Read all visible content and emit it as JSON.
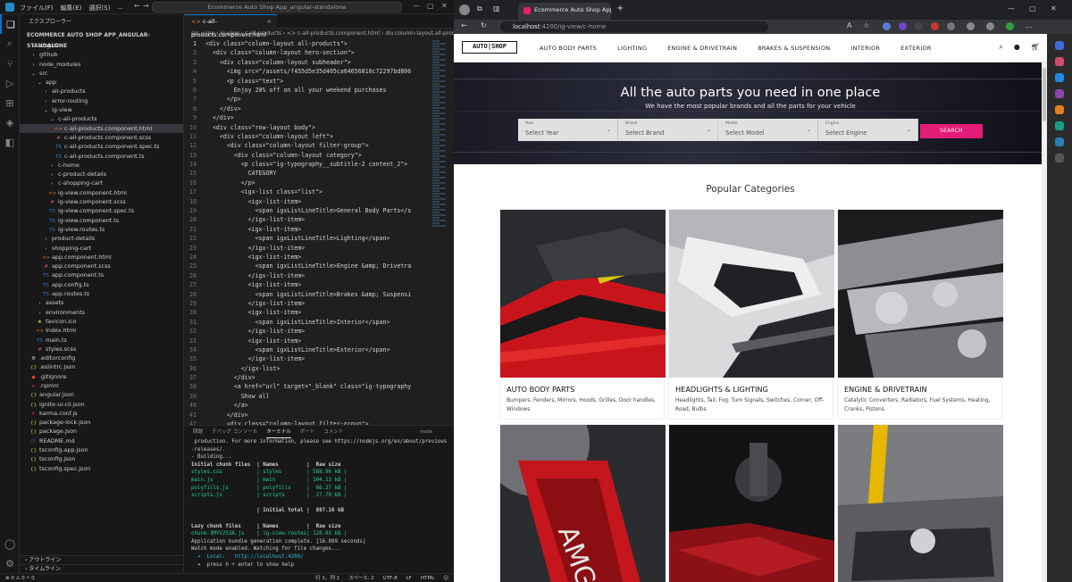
{
  "vscode": {
    "menus": [
      "ファイル(F)",
      "編集(E)",
      "選択(S)",
      "..."
    ],
    "command_center": "Ecommerce Auto Shop App_angular-standalone",
    "explorer_title": "エクスプローラー",
    "project_name": "ECOMMERCE AUTO SHOP APP_ANGULAR-STANDALONE",
    "tree": [
      {
        "label": "angular",
        "indent": 1,
        "icon": "›"
      },
      {
        "label": "github",
        "indent": 1,
        "icon": "›"
      },
      {
        "label": "node_modules",
        "indent": 1,
        "icon": "›"
      },
      {
        "label": "src",
        "indent": 1,
        "icon": "⌄"
      },
      {
        "label": "app",
        "indent": 2,
        "icon": "⌄"
      },
      {
        "label": "all-products",
        "indent": 3,
        "icon": "›"
      },
      {
        "label": "error-routing",
        "indent": 3,
        "icon": "›"
      },
      {
        "label": "ig-view",
        "indent": 3,
        "icon": "⌄"
      },
      {
        "label": "c-all-products",
        "indent": 4,
        "icon": "⌄"
      },
      {
        "label": "c-all-products.component.html",
        "indent": 5,
        "icon": "<>",
        "selected": true
      },
      {
        "label": "c-all-products.component.scss",
        "indent": 5,
        "icon": "#"
      },
      {
        "label": "c-all-products.component.spec.ts",
        "indent": 5,
        "icon": "TS"
      },
      {
        "label": "c-all-products.component.ts",
        "indent": 5,
        "icon": "TS"
      },
      {
        "label": "c-home",
        "indent": 4,
        "icon": "›"
      },
      {
        "label": "c-product-details",
        "indent": 4,
        "icon": "›"
      },
      {
        "label": "c-shopping-cart",
        "indent": 4,
        "icon": "›"
      },
      {
        "label": "ig-view.component.html",
        "indent": 4,
        "icon": "<>"
      },
      {
        "label": "ig-view.component.scss",
        "indent": 4,
        "icon": "#"
      },
      {
        "label": "ig-view.component.spec.ts",
        "indent": 4,
        "icon": "TS"
      },
      {
        "label": "ig-view.component.ts",
        "indent": 4,
        "icon": "TS"
      },
      {
        "label": "ig-view.routes.ts",
        "indent": 4,
        "icon": "TS"
      },
      {
        "label": "product-details",
        "indent": 3,
        "icon": "›"
      },
      {
        "label": "shopping-cart",
        "indent": 3,
        "icon": "›"
      },
      {
        "label": "app.component.html",
        "indent": 3,
        "icon": "<>"
      },
      {
        "label": "app.component.scss",
        "indent": 3,
        "icon": "#"
      },
      {
        "label": "app.component.ts",
        "indent": 3,
        "icon": "TS"
      },
      {
        "label": "app.config.ts",
        "indent": 3,
        "icon": "TS"
      },
      {
        "label": "app.routes.ts",
        "indent": 3,
        "icon": "TS"
      },
      {
        "label": "assets",
        "indent": 2,
        "icon": "›"
      },
      {
        "label": "environments",
        "indent": 2,
        "icon": "›"
      },
      {
        "label": "favicon.ico",
        "indent": 2,
        "icon": "★"
      },
      {
        "label": "index.html",
        "indent": 2,
        "icon": "<>"
      },
      {
        "label": "main.ts",
        "indent": 2,
        "icon": "TS"
      },
      {
        "label": "styles.scss",
        "indent": 2,
        "icon": "#"
      },
      {
        "label": ".editorconfig",
        "indent": 1,
        "icon": "⚙"
      },
      {
        "label": ".eslintrc.json",
        "indent": 1,
        "icon": "{}"
      },
      {
        "label": ".gitignore",
        "indent": 1,
        "icon": "◆"
      },
      {
        "label": ".npmrc",
        "indent": 1,
        "icon": "n"
      },
      {
        "label": "angular.json",
        "indent": 1,
        "icon": "{}"
      },
      {
        "label": "ignite-ui-cli.json",
        "indent": 1,
        "icon": "{}"
      },
      {
        "label": "karma.conf.js",
        "indent": 1,
        "icon": "K"
      },
      {
        "label": "package-lock.json",
        "indent": 1,
        "icon": "{}"
      },
      {
        "label": "package.json",
        "indent": 1,
        "icon": "{}"
      },
      {
        "label": "README.md",
        "indent": 1,
        "icon": "ⓘ"
      },
      {
        "label": "tsconfig.app.json",
        "indent": 1,
        "icon": "{}"
      },
      {
        "label": "tsconfig.json",
        "indent": 1,
        "icon": "{}"
      },
      {
        "label": "tsconfig.spec.json",
        "indent": 1,
        "icon": "{}"
      }
    ],
    "outline_label": "アウトライン",
    "timeline_label": "タイムライン",
    "tab_label": "c-all-products.component.html",
    "breadcrumb": "src › app › ig-view › c-all-products › <> c-all-products.component.html › div.column-layout.all-products",
    "code": [
      {
        "n": "1",
        "t": "<div class=\"column-layout all-products\">"
      },
      {
        "n": "2",
        "t": "  <div class=\"column-layout hero-section\">"
      },
      {
        "n": "3",
        "t": "    <div class=\"column-layout subheader\">"
      },
      {
        "n": "4",
        "t": "      <img src=\"/assets/f455d5e35d405ca64656810c72297bd806"
      },
      {
        "n": "5",
        "t": "      <p class=\"text\">"
      },
      {
        "n": "6",
        "t": "        Enjoy 20% off on all your weekend purchases"
      },
      {
        "n": "7",
        "t": "      </p>"
      },
      {
        "n": "8",
        "t": "    </div>"
      },
      {
        "n": "9",
        "t": "  </div>"
      },
      {
        "n": "10",
        "t": "  <div class=\"row-layout body\">"
      },
      {
        "n": "11",
        "t": "    <div class=\"column-layout left\">"
      },
      {
        "n": "12",
        "t": "      <div class=\"column-layout filter-group\">"
      },
      {
        "n": "13",
        "t": "        <div class=\"column-layout category\">"
      },
      {
        "n": "14",
        "t": "          <p class=\"ig-typography__subtitle-2 content_2\">"
      },
      {
        "n": "15",
        "t": "            CATEGORY"
      },
      {
        "n": "16",
        "t": "          </p>"
      },
      {
        "n": "17",
        "t": "          <igx-list class=\"list\">"
      },
      {
        "n": "18",
        "t": "            <igx-list-item>"
      },
      {
        "n": "19",
        "t": "              <span igxListLineTitle>General Body Parts</s"
      },
      {
        "n": "20",
        "t": "            </igx-list-item>"
      },
      {
        "n": "21",
        "t": "            <igx-list-item>"
      },
      {
        "n": "22",
        "t": "              <span igxListLineTitle>Lighting</span>"
      },
      {
        "n": "23",
        "t": "            </igx-list-item>"
      },
      {
        "n": "24",
        "t": "            <igx-list-item>"
      },
      {
        "n": "25",
        "t": "              <span igxListLineTitle>Engine &amp; Drivetra"
      },
      {
        "n": "26",
        "t": "            </igx-list-item>"
      },
      {
        "n": "27",
        "t": "            <igx-list-item>"
      },
      {
        "n": "28",
        "t": "              <span igxListLineTitle>Brakes &amp; Suspensi"
      },
      {
        "n": "29",
        "t": "            </igx-list-item>"
      },
      {
        "n": "30",
        "t": "            <igx-list-item>"
      },
      {
        "n": "31",
        "t": "              <span igxListLineTitle>Interior</span>"
      },
      {
        "n": "32",
        "t": "            </igx-list-item>"
      },
      {
        "n": "33",
        "t": "            <igx-list-item>"
      },
      {
        "n": "34",
        "t": "              <span igxListLineTitle>Exterior</span>"
      },
      {
        "n": "35",
        "t": "            </igx-list-item>"
      },
      {
        "n": "36",
        "t": "          </igx-list>"
      },
      {
        "n": "37",
        "t": "        </div>"
      },
      {
        "n": "38",
        "t": "        <a href=\"url\" target=\"_blank\" class=\"ig-typography"
      },
      {
        "n": "39",
        "t": "          Show all"
      },
      {
        "n": "40",
        "t": "        </a>"
      },
      {
        "n": "41",
        "t": "      </div>"
      },
      {
        "n": "42",
        "t": "      <div class=\"column-layout filter-group\">"
      }
    ],
    "panel_tabs": [
      "問題",
      "デバッグ コンソール",
      "ターミナル",
      "ポート",
      "コメント"
    ],
    "panel_active": "ターミナル",
    "terminal_shell": "node",
    "terminal": [
      " production. For more information, please see https://nodejs.org/en/about/previous",
      "-releases/.",
      "- Building...",
      "Initial chunk files  | Names         |  Raw size",
      "styles.css           | styles        | 588.96 kB |",
      "main.js              | main          | 104.13 kB |",
      "polyfills.js         | polyfills     |  86.27 kB |",
      "scripts.js           | scripts       |  27.79 kB |",
      "",
      "                     | Initial total |  807.16 kB",
      "",
      "Lazy chunk files     | Names         |  Raw size",
      "chunk-3MYV253A.js    | ig-view-routes| 120.01 kB |",
      "Application bundle generation complete. [16.899 seconds]",
      "Watch mode enabled. Watching for file changes...",
      "  ➜  Local:   http://localhost:4200/",
      "  ➜  press h + enter to show help"
    ],
    "status_left": "⊗ 0 ⚠ 0   ⚡ 0",
    "status_right": [
      "行 1、列 1",
      "スペース: 2",
      "UTF-8",
      "LF",
      "HTML",
      "☺"
    ]
  },
  "browser": {
    "tab_title": "Ecommerce Auto Shop App (lo...",
    "url_host": "localhost",
    "url_path": ":4200/ig-view/c-home"
  },
  "site": {
    "brand": "AUTO|SHOP",
    "nav": [
      "AUTO BODY PARTS",
      "LIGHTING",
      "ENGINE & DRIVETRAIN",
      "BRAKES & SUSPENSION",
      "INTERIOR",
      "EXTERIOR"
    ],
    "hero_title": "All the auto parts you need in one place",
    "hero_subtitle": "We have the most popular brands and all the parts for your vehicle",
    "filters": [
      {
        "label": "Year",
        "placeholder": "Select Year"
      },
      {
        "label": "Brand",
        "placeholder": "Select Brand"
      },
      {
        "label": "Model",
        "placeholder": "Select Model"
      },
      {
        "label": "Engine",
        "placeholder": "Select Engine"
      }
    ],
    "search_button": "SEARCH",
    "popular_title": "Popular Categories",
    "categories": [
      {
        "title": "AUTO BODY PARTS",
        "desc": "Bumpers, Fenders, Mirrors, Hoods, Grilles, Door handles, Windows"
      },
      {
        "title": "HEADLIGHTS & LIGHTING",
        "desc": "Headlights, Tail, Fog, Turn Signals, Switches, Corner, Off-Road, Bulbs"
      },
      {
        "title": "ENGINE & DRIVETRAIN",
        "desc": "Catalytic Converters, Radiators, Fuel Systems, Heating, Cranks, Pistons"
      }
    ],
    "accent_color": "#e41c77"
  }
}
